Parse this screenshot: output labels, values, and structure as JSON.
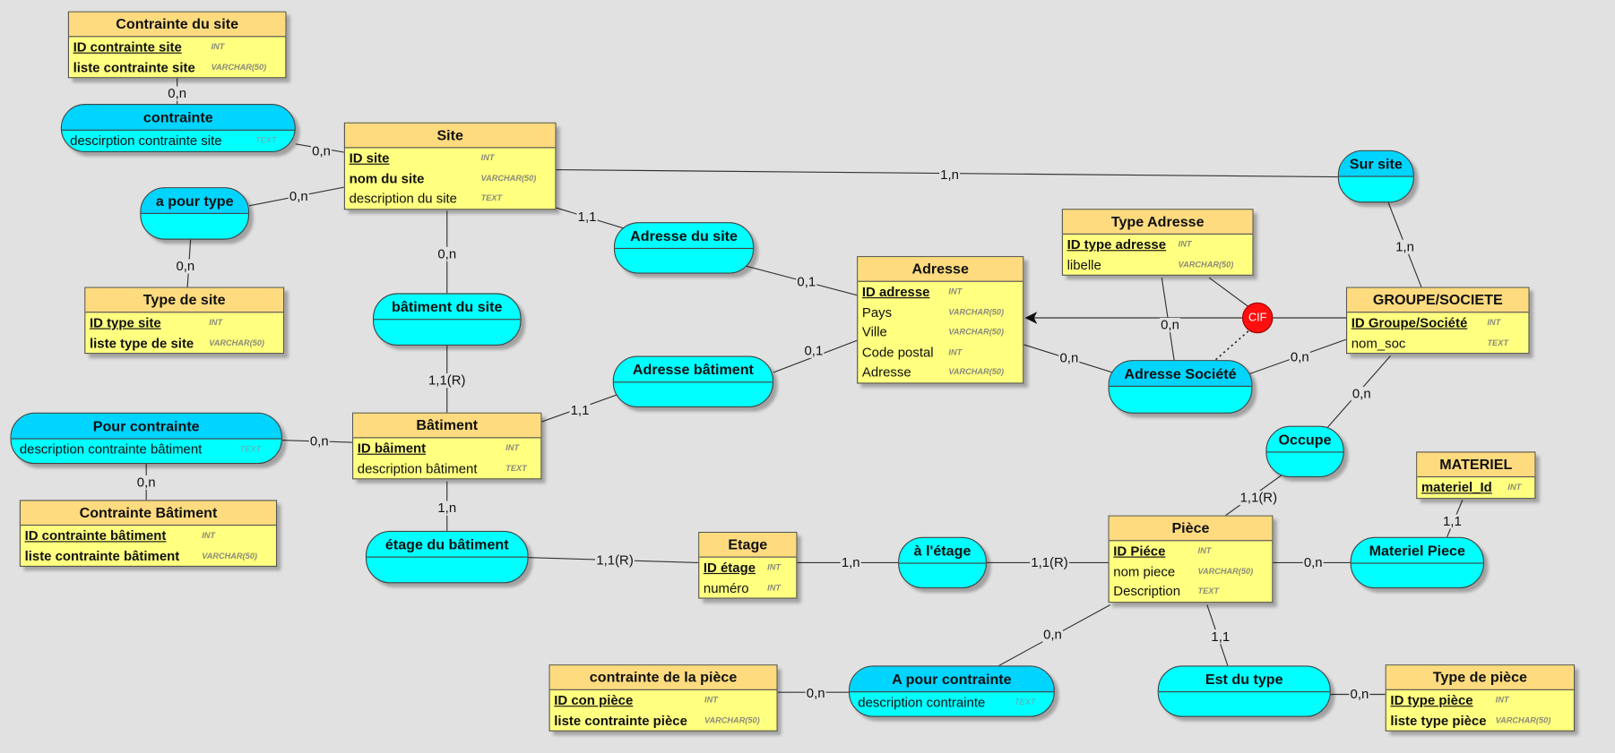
{
  "entities": [
    {
      "title": "Contrainte du site",
      "attributes": [
        {
          "name": "ID contrainte site",
          "type": "INT",
          "key": true
        },
        {
          "name": "liste contrainte site",
          "type": "VARCHAR(50)",
          "bold": true
        }
      ]
    },
    {
      "title": "Site",
      "attributes": [
        {
          "name": "ID site",
          "type": "INT",
          "key": true
        },
        {
          "name": "nom du site",
          "type": "VARCHAR(50)",
          "bold": true
        },
        {
          "name": "description du site",
          "type": "TEXT"
        }
      ]
    },
    {
      "title": "Type de site",
      "attributes": [
        {
          "name": "ID type site",
          "type": "INT",
          "key": true
        },
        {
          "name": "liste type de site",
          "type": "VARCHAR(50)",
          "bold": true
        }
      ]
    },
    {
      "title": "Adresse",
      "attributes": [
        {
          "name": "ID adresse",
          "type": "INT",
          "key": true
        },
        {
          "name": "Pays",
          "type": "VARCHAR(50)"
        },
        {
          "name": "Ville",
          "type": "VARCHAR(50)"
        },
        {
          "name": "Code postal",
          "type": "INT"
        },
        {
          "name": "Adresse",
          "type": "VARCHAR(50)"
        }
      ]
    },
    {
      "title": "Type Adresse",
      "attributes": [
        {
          "name": "ID type adresse",
          "type": "INT",
          "key": true
        },
        {
          "name": "libelle",
          "type": "VARCHAR(50)"
        }
      ]
    },
    {
      "title": "GROUPE/SOCIETE",
      "attributes": [
        {
          "name": "ID Groupe/Société",
          "type": "INT",
          "key": true
        },
        {
          "name": "nom_soc",
          "type": "TEXT"
        }
      ]
    },
    {
      "title": "Bâtiment",
      "attributes": [
        {
          "name": "ID bâiment",
          "type": "INT",
          "key": true
        },
        {
          "name": "description bâtiment",
          "type": "TEXT"
        }
      ]
    },
    {
      "title": "Contrainte Bâtiment",
      "attributes": [
        {
          "name": "ID contrainte bâtiment",
          "type": "INT",
          "key": true
        },
        {
          "name": "liste contrainte bâtiment",
          "type": "VARCHAR(50)",
          "bold": true
        }
      ]
    },
    {
      "title": "Etage",
      "attributes": [
        {
          "name": "ID étage",
          "type": "INT",
          "key": true
        },
        {
          "name": "numéro",
          "type": "INT"
        }
      ]
    },
    {
      "title": "Pièce",
      "attributes": [
        {
          "name": "ID Piéce",
          "type": "INT",
          "key": true
        },
        {
          "name": "nom piece",
          "type": "VARCHAR(50)"
        },
        {
          "name": "Description",
          "type": "TEXT"
        }
      ]
    },
    {
      "title": "MATERIEL",
      "attributes": [
        {
          "name": "materiel_Id",
          "type": "INT",
          "key": true
        }
      ]
    },
    {
      "title": "contrainte de la pièce",
      "attributes": [
        {
          "name": "ID con pièce",
          "type": "INT",
          "key": true
        },
        {
          "name": "liste contrainte pièce",
          "type": "VARCHAR(50)",
          "bold": true
        }
      ]
    },
    {
      "title": "Type de pièce",
      "attributes": [
        {
          "name": "ID type pièce",
          "type": "INT",
          "key": true
        },
        {
          "name": "liste type pièce",
          "type": "VARCHAR(50)",
          "bold": true
        }
      ]
    }
  ],
  "associations": [
    {
      "title": "contrainte",
      "attributes": [
        {
          "name": "descirption contrainte site",
          "type": "TEXT"
        }
      ],
      "dark": true
    },
    {
      "title": "a pour type",
      "attributes": [],
      "dark": true
    },
    {
      "title": "Sur site",
      "attributes": [],
      "dark": true
    },
    {
      "title": "Adresse du site",
      "attributes": []
    },
    {
      "title": "bâtiment du site",
      "attributes": []
    },
    {
      "title": "Adresse bâtiment",
      "attributes": []
    },
    {
      "title": "Adresse Société",
      "attributes": [],
      "dark": true
    },
    {
      "title": "Pour contrainte",
      "attributes": [
        {
          "name": "description contrainte bâtiment",
          "type": "TEXT"
        }
      ],
      "dark": true
    },
    {
      "title": "Occupe",
      "attributes": []
    },
    {
      "title": "étage du bâtiment",
      "attributes": []
    },
    {
      "title": "à l'étage",
      "attributes": []
    },
    {
      "title": "Materiel Piece",
      "attributes": []
    },
    {
      "title": "A pour contrainte",
      "attributes": [
        {
          "name": "description contrainte",
          "type": "TEXT"
        }
      ],
      "dark": true
    },
    {
      "title": "Est du type",
      "attributes": []
    }
  ],
  "links": [
    {
      "between": [
        "Contrainte du site",
        "contrainte"
      ],
      "cardinality": "0,n"
    },
    {
      "between": [
        "contrainte",
        "Site"
      ],
      "cardinality": "0,n"
    },
    {
      "between": [
        "a pour type",
        "Site"
      ],
      "cardinality": "0,n"
    },
    {
      "between": [
        "a pour type",
        "Type de site"
      ],
      "cardinality": "0,n"
    },
    {
      "between": [
        "Site",
        "Sur site"
      ],
      "cardinality": "1,n"
    },
    {
      "between": [
        "Site",
        "Adresse du site"
      ],
      "cardinality": "1,1"
    },
    {
      "between": [
        "Site",
        "bâtiment du site"
      ],
      "cardinality": "0,n"
    },
    {
      "between": [
        "Adresse du site",
        "Adresse"
      ],
      "cardinality": "0,1"
    },
    {
      "between": [
        "bâtiment du site",
        "Bâtiment"
      ],
      "cardinality": "1,1(R)"
    },
    {
      "between": [
        "Adresse bâtiment",
        "Adresse"
      ],
      "cardinality": "0,1"
    },
    {
      "between": [
        "Bâtiment",
        "Adresse bâtiment"
      ],
      "cardinality": "1,1"
    },
    {
      "between": [
        "Pour contrainte",
        "Bâtiment"
      ],
      "cardinality": "0,n"
    },
    {
      "between": [
        "Pour contrainte",
        "Contrainte Bâtiment"
      ],
      "cardinality": "0,n"
    },
    {
      "between": [
        "Bâtiment",
        "étage du bâtiment"
      ],
      "cardinality": "1,n"
    },
    {
      "between": [
        "étage du bâtiment",
        "Etage"
      ],
      "cardinality": "1,1(R)"
    },
    {
      "between": [
        "Etage",
        "à l'étage"
      ],
      "cardinality": "1,n"
    },
    {
      "between": [
        "à l'étage",
        "Pièce"
      ],
      "cardinality": "1,1(R)"
    },
    {
      "between": [
        "Pièce",
        "Materiel Piece"
      ],
      "cardinality": "0,n"
    },
    {
      "between": [
        "MATERIEL",
        "Materiel Piece"
      ],
      "cardinality": "1,1"
    },
    {
      "between": [
        "Occupe",
        "Pièce"
      ],
      "cardinality": "1,1(R)"
    },
    {
      "between": [
        "GROUPE/SOCIETE",
        "Occupe"
      ],
      "cardinality": "0,n"
    },
    {
      "between": [
        "Sur site",
        "GROUPE/SOCIETE"
      ],
      "cardinality": "1,n"
    },
    {
      "between": [
        "Pièce",
        "A pour contrainte"
      ],
      "cardinality": "0,n"
    },
    {
      "between": [
        "Pièce",
        "Est du type"
      ],
      "cardinality": "1,1"
    },
    {
      "between": [
        "contrainte de la pièce",
        "A pour contrainte"
      ],
      "cardinality": "0,n"
    },
    {
      "between": [
        "Est du type",
        "Type de pièce"
      ],
      "cardinality": "0,n"
    },
    {
      "between": [
        "Adresse",
        "Adresse Société"
      ],
      "cardinality": "0,n"
    },
    {
      "between": [
        "Adresse Société",
        "GROUPE/SOCIETE"
      ],
      "cardinality": "0,n"
    },
    {
      "between": [
        "Type Adresse",
        "Adresse Société"
      ],
      "cardinality": "0,n"
    }
  ],
  "cif": {
    "label": "CIF",
    "color": "#ff1010"
  },
  "colors": {
    "entity_header": "#fedb7f",
    "entity_body": "#ffff80",
    "association_body": "#00ffff",
    "association_header_dark": "#00d4ff",
    "background": "#e1e1e1"
  }
}
